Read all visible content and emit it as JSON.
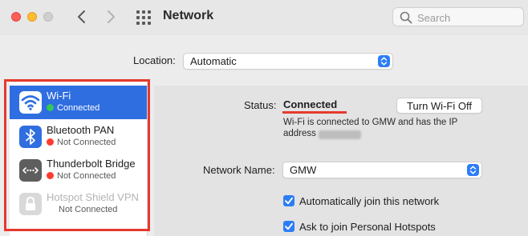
{
  "window": {
    "title": "Network"
  },
  "search": {
    "placeholder": "Search"
  },
  "location": {
    "label": "Location:",
    "value": "Automatic"
  },
  "services": [
    {
      "name": "Wi-Fi",
      "status": "Connected",
      "status_color": "#34c759",
      "icon": "wifi-icon",
      "selected": true
    },
    {
      "name": "Bluetooth PAN",
      "status": "Not Connected",
      "status_color": "#ff3b30",
      "icon": "bluetooth-icon"
    },
    {
      "name": "Thunderbolt Bridge",
      "status": "Not Connected",
      "status_color": "#ff3b30",
      "icon": "thunderbolt-bridge-icon"
    },
    {
      "name": "Hotspot Shield VPN",
      "status": "Not Connected",
      "icon": "lock-icon",
      "disabled": true
    }
  ],
  "detail": {
    "status_label": "Status:",
    "status_value": "Connected",
    "turn_off_label": "Turn Wi-Fi Off",
    "status_desc_line1": "Wi-Fi is connected to GMW and has the IP",
    "status_desc_line2": "address",
    "network_name_label": "Network Name:",
    "network_name_value": "GMW",
    "auto_join_label": "Automatically join this network",
    "ask_hotspots_label": "Ask to join Personal Hotspots"
  },
  "colors": {
    "accent": "#2d7df6",
    "selection": "#2f6ee0",
    "annotation": "#e53a2d"
  }
}
